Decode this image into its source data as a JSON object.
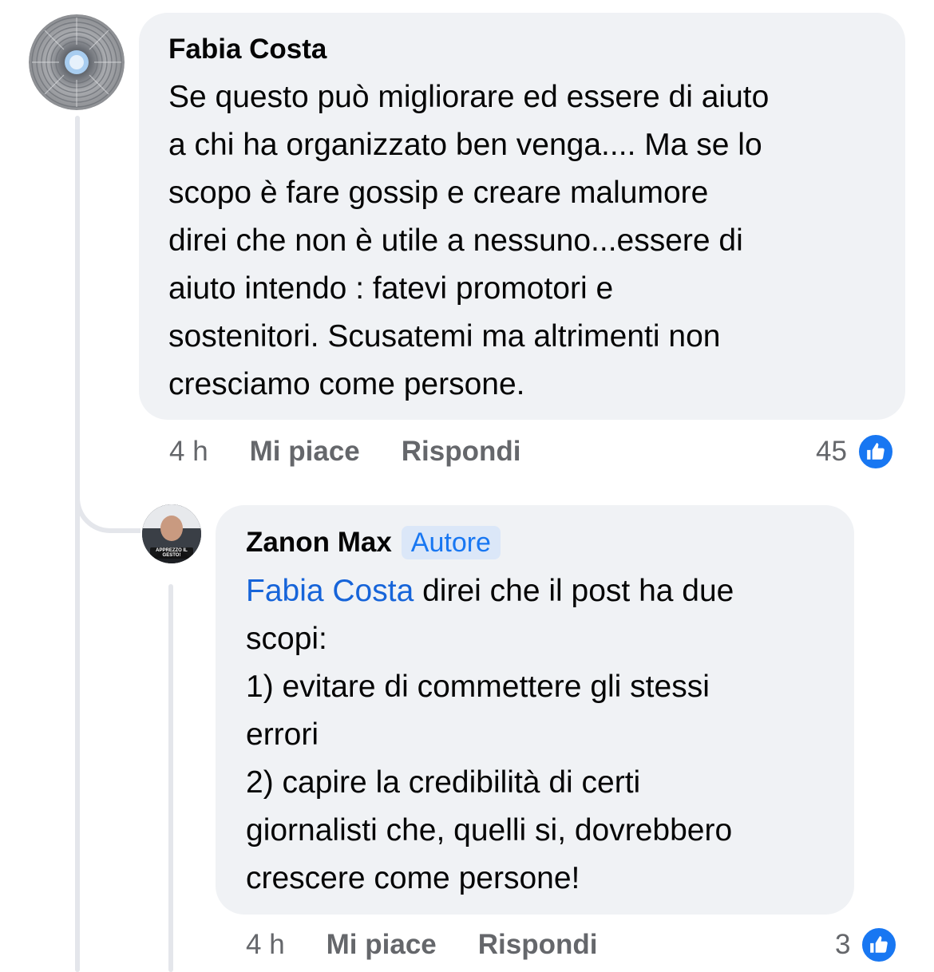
{
  "comment": {
    "author": "Fabia Costa",
    "text": "Se questo può migliorare ed essere di aiuto\na chi ha organizzato ben venga.... Ma se lo\nscopo è fare gossip e creare malumore\ndirei che non è utile a nessuno...essere di\naiuto intendo : fatevi promotori e\nsostenitori. Scusatemi ma altrimenti non\ncresciamo come persone.",
    "time": "4 h",
    "like_label": "Mi piace",
    "reply_label": "Rispondi",
    "reaction_count": "45",
    "reaction_icon": "like-icon"
  },
  "reply": {
    "author": "Zanon Max",
    "badge": "Autore",
    "mention": "Fabia Costa",
    "text": " direi che il post ha due\nscopi:\n1) evitare di commettere gli stessi\nerrori\n2) capire la credibilità di certi\ngiornalisti che, quelli si, dovrebbero\ncrescere come persone!",
    "time": "4 h",
    "like_label": "Mi piace",
    "reply_label": "Rispondi",
    "reaction_count": "3",
    "reaction_icon": "like-icon",
    "avatar_caption": "APPREZZO IL GESTO!"
  },
  "colors": {
    "bubble": "#f0f2f5",
    "link": "#1664d9",
    "like": "#1877f2",
    "muted": "#65676b",
    "thread_line": "#e4e6eb"
  }
}
